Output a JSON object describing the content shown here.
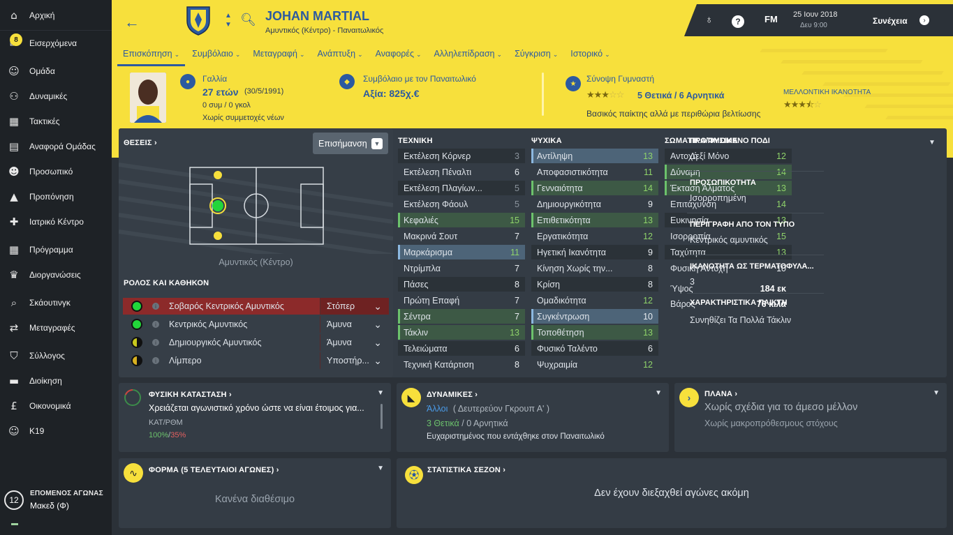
{
  "sidebar": {
    "items": [
      {
        "label": "Αρχική",
        "icon": "home-icon"
      },
      {
        "label": "Εισερχόμενα",
        "icon": "inbox-icon",
        "badge": "8"
      },
      {
        "label": "Ομάδα",
        "icon": "squad-icon"
      },
      {
        "label": "Δυναμικές",
        "icon": "dynamics-icon"
      },
      {
        "label": "Τακτικές",
        "icon": "tactics-icon"
      },
      {
        "label": "Αναφορά Ομάδας",
        "icon": "report-icon"
      },
      {
        "label": "Προσωπικό",
        "icon": "staff-icon"
      },
      {
        "label": "Προπόνηση",
        "icon": "training-icon"
      },
      {
        "label": "Ιατρικό Κέντρο",
        "icon": "medical-icon"
      },
      {
        "label": "Πρόγραμμα",
        "icon": "calendar-icon"
      },
      {
        "label": "Διοργανώσεις",
        "icon": "trophy-icon"
      },
      {
        "label": "Σκάουτινγκ",
        "icon": "scouting-icon"
      },
      {
        "label": "Μεταγραφές",
        "icon": "transfers-icon"
      },
      {
        "label": "Σύλλογος",
        "icon": "club-icon"
      },
      {
        "label": "Διοίκηση",
        "icon": "board-icon"
      },
      {
        "label": "Οικονομικά",
        "icon": "finances-icon"
      },
      {
        "label": "K19",
        "icon": "u19-icon"
      }
    ],
    "next_match": {
      "title": "ΕΠΟΜΕΝΟΣ ΑΓΩΝΑΣ",
      "number": "12",
      "opponent": "Μακεδ (Φ)"
    }
  },
  "header": {
    "player_name": "JOHAN MARTIAL",
    "subtitle": "Αμυντικός (Κέντρο) - Παναιτωλικός",
    "date": "25 Ιουν 2018",
    "time": "Δευ 9:00",
    "fm": "FM",
    "continue": "Συνέχεια",
    "help": "?"
  },
  "tabs": [
    {
      "label": "Επισκόπηση"
    },
    {
      "label": "Συμβόλαιο"
    },
    {
      "label": "Μεταγραφή"
    },
    {
      "label": "Ανάπτυξη"
    },
    {
      "label": "Αναφορές"
    },
    {
      "label": "Αλληλεπίδραση"
    },
    {
      "label": "Σύγκριση"
    },
    {
      "label": "Ιστορικό"
    }
  ],
  "info": {
    "nationality": "Γαλλία",
    "age": "27 ετών",
    "dob": "(30/5/1991)",
    "caps": "0 συμ / 0 γκολ",
    "youth": "Χωρίς συμμετοχές νέων",
    "contract": "Συμβόλαιο με τον Παναιτωλικό",
    "value": "Αξία: 825χ.€",
    "coach_summary": "Σύνοψη Γυμναστή",
    "current_ability_stars": 3,
    "pros_cons": "5 Θετικά / 6 Αρνητικά",
    "potential_label": "ΜΕΛΛΟΝΤΙΚΗ ΙΚΑΝΟΤΗΤΑ",
    "potential_stars": 3.5,
    "coach_comment": "Βασικός παίκτης αλλά με περιθώρια βελτίωσης"
  },
  "positions": {
    "title": "ΘΕΣΕΙΣ",
    "dropdown": "Επισήμανση",
    "caption": "Αμυντικός (Κέντρο)",
    "roles_title": "ΡΟΛΟΣ ΚΑΙ ΚΑΘΗΚΟΝ"
  },
  "roles": [
    {
      "name": "Σοβαρός Κεντρικός Αμυντικός",
      "duty": "Στόπερ",
      "color": "#22d63a"
    },
    {
      "name": "Κεντρικός Αμυντικός",
      "duty": "Άμυνα",
      "color": "#22d63a"
    },
    {
      "name": "Δημιουργικός Αμυντικός",
      "duty": "Άμυνα",
      "color": "#c8c81e"
    },
    {
      "name": "Λίμπερο",
      "duty": "Υποστήρ...",
      "color": "#d8b020"
    }
  ],
  "technical": {
    "title": "ΤΕΧΝΙΚΗ",
    "rows": [
      {
        "name": "Εκτέλεση Κόρνερ",
        "value": "3"
      },
      {
        "name": "Εκτέλεση Πέναλτι",
        "value": "6"
      },
      {
        "name": "Εκτέλεση Πλαγίων...",
        "value": "5"
      },
      {
        "name": "Εκτέλεση Φάουλ",
        "value": "5"
      },
      {
        "name": "Κεφαλιές",
        "value": "15"
      },
      {
        "name": "Μακρινά Σουτ",
        "value": "7"
      },
      {
        "name": "Μαρκάρισμα",
        "value": "11"
      },
      {
        "name": "Ντρίμπλα",
        "value": "7"
      },
      {
        "name": "Πάσες",
        "value": "8"
      },
      {
        "name": "Πρώτη Επαφή",
        "value": "7"
      },
      {
        "name": "Σέντρα",
        "value": "7"
      },
      {
        "name": "Τάκλιν",
        "value": "13"
      },
      {
        "name": "Τελειώματα",
        "value": "6"
      },
      {
        "name": "Τεχνική Κατάρτιση",
        "value": "8"
      }
    ]
  },
  "mental": {
    "title": "ΨΥΧΙΚΑ",
    "rows": [
      {
        "name": "Αντίληψη",
        "value": "13"
      },
      {
        "name": "Αποφασιστικότητα",
        "value": "11"
      },
      {
        "name": "Γενναιότητα",
        "value": "14"
      },
      {
        "name": "Δημιουργικότητα",
        "value": "9"
      },
      {
        "name": "Επιθετικότητα",
        "value": "13"
      },
      {
        "name": "Εργατικότητα",
        "value": "12"
      },
      {
        "name": "Ηγετική Ικανότητα",
        "value": "9"
      },
      {
        "name": "Κίνηση Χωρίς την...",
        "value": "8"
      },
      {
        "name": "Κρίση",
        "value": "8"
      },
      {
        "name": "Ομαδικότητα",
        "value": "12"
      },
      {
        "name": "Συγκέντρωση",
        "value": "10"
      },
      {
        "name": "Τοποθέτηση",
        "value": "13"
      },
      {
        "name": "Φυσικό Ταλέντο",
        "value": "6"
      },
      {
        "name": "Ψυχραιμία",
        "value": "12"
      }
    ]
  },
  "physical": {
    "title": "ΣΩΜΑΤΙΚΑ/ΦΥΣΙΚΑ",
    "rows": [
      {
        "name": "Αντοχή",
        "value": "12"
      },
      {
        "name": "Δύναμη",
        "value": "14"
      },
      {
        "name": "Έκταση Άλματος",
        "value": "13"
      },
      {
        "name": "Επιτάχυνση",
        "value": "14"
      },
      {
        "name": "Ευκινησία",
        "value": "13"
      },
      {
        "name": "Ισορροπία",
        "value": "15"
      },
      {
        "name": "Ταχύτητα",
        "value": "13"
      },
      {
        "name": "Φυσική Αντοχή",
        "value": "10"
      }
    ],
    "height_label": "Ύψος",
    "height": "184 εκ",
    "weight_label": "Βάρος",
    "weight": "76 κιλά"
  },
  "right_info": {
    "foot_label": "ΠΡΟΤΙΜΩΜΕΝΟ ΠΟΔΙ",
    "foot": "Δεξί Μόνο",
    "personality_label": "ΠΡΟΣΩΠΙΚΟΤΗΤΑ",
    "personality": "Ισορροπημένη",
    "media_label": "ΠΕΡΙΓΡΑΦΗ ΑΠΟ ΤΟΝ ΤΥΠΟ",
    "media": "Κεντρικός αμυντικός",
    "gk_label": "ΙΚΑΝΟΤΗΤΑ ΩΣ ΤΕΡΜΑΤΟΦΥΛΑ...",
    "gk": "3",
    "traits_label": "ΧΑΡΑΚΤΗΡΙΣΤΙΚΑ ΠΑΙΚΤΗ",
    "traits": "Συνηθίζει Τα Πολλά Τάκλιν"
  },
  "condition": {
    "title": "ΦΥΣΙΚΗ ΚΑΤΑΣΤΑΣΗ",
    "text": "Χρειάζεται αγωνιστικό χρόνο ώστε να είναι έτοιμος για...",
    "label": "ΚΑΤ/ΡΘΜ",
    "v1": "100%",
    "sep": "/",
    "v2": "35%"
  },
  "dynamics": {
    "title": "ΔΥΝΑΜΙΚΕΣ",
    "group": "Άλλοι",
    "group_sub": "( Δευτερεύον Γκρουπ Α' )",
    "pos": "3 Θετικά",
    "sep": "/",
    "neg": "0 Αρνητικά",
    "text": "Ευχαριστημένος που εντάχθηκε στον Παναιτωλικό"
  },
  "plans": {
    "title": "ΠΛΑΝΑ",
    "main": "Χωρίς σχέδια για το άμεσο μέλλον",
    "sub": "Χωρίς μακροπρόθεσμους στόχους"
  },
  "form": {
    "title": "ΦΟΡΜΑ (5 ΤΕΛΕΥΤΑΙΟΙ ΑΓΩΝΕΣ)",
    "empty": "Κανένα διαθέσιμο"
  },
  "season": {
    "title": "ΣΤΑΤΙΣΤΙΚΑ ΣΕΖΟΝ",
    "empty": "Δεν έχουν διεξαχθεί αγώνες ακόμη"
  }
}
